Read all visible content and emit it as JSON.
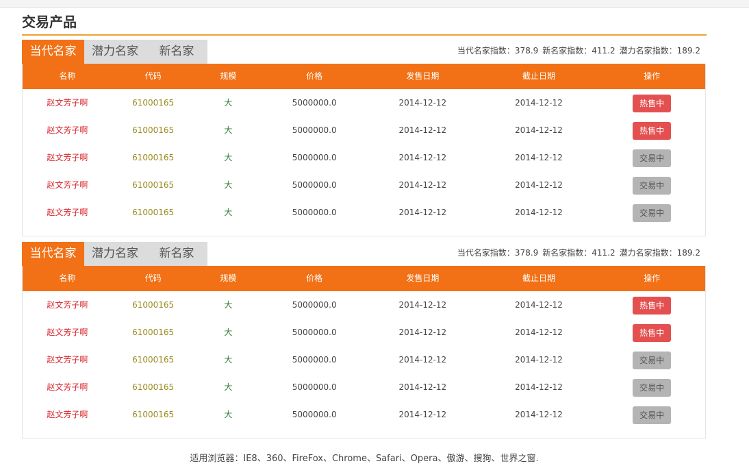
{
  "page": {
    "title": "交易产品"
  },
  "blocks": [
    {
      "tabs": [
        "当代名家",
        "潜力名家",
        "新名家"
      ],
      "active_tab": 0,
      "indices": [
        "当代名家指数：378.9",
        "新名家指数：411.2",
        "潜力名家指数：189.2"
      ],
      "headers": [
        "名称",
        "代码",
        "规模",
        "价格",
        "发售日期",
        "截止日期",
        "操作"
      ],
      "rows": [
        {
          "name": "赵文芳子啊",
          "code": "61000165",
          "scale": "大",
          "price": "5000000.0",
          "start": "2014-12-12",
          "end": "2014-12-12",
          "action": "热售中",
          "status": "hot"
        },
        {
          "name": "赵文芳子啊",
          "code": "61000165",
          "scale": "大",
          "price": "5000000.0",
          "start": "2014-12-12",
          "end": "2014-12-12",
          "action": "热售中",
          "status": "hot"
        },
        {
          "name": "赵文芳子啊",
          "code": "61000165",
          "scale": "大",
          "price": "5000000.0",
          "start": "2014-12-12",
          "end": "2014-12-12",
          "action": "交易中",
          "status": "trade"
        },
        {
          "name": "赵文芳子啊",
          "code": "61000165",
          "scale": "大",
          "price": "5000000.0",
          "start": "2014-12-12",
          "end": "2014-12-12",
          "action": "交易中",
          "status": "trade"
        },
        {
          "name": "赵文芳子啊",
          "code": "61000165",
          "scale": "大",
          "price": "5000000.0",
          "start": "2014-12-12",
          "end": "2014-12-12",
          "action": "交易中",
          "status": "trade"
        }
      ]
    },
    {
      "tabs": [
        "当代名家",
        "潜力名家",
        "新名家"
      ],
      "active_tab": 0,
      "indices": [
        "当代名家指数：378.9",
        "新名家指数：411.2",
        "潜力名家指数：189.2"
      ],
      "headers": [
        "名称",
        "代码",
        "规模",
        "价格",
        "发售日期",
        "截止日期",
        "操作"
      ],
      "rows": [
        {
          "name": "赵文芳子啊",
          "code": "61000165",
          "scale": "大",
          "price": "5000000.0",
          "start": "2014-12-12",
          "end": "2014-12-12",
          "action": "热售中",
          "status": "hot"
        },
        {
          "name": "赵文芳子啊",
          "code": "61000165",
          "scale": "大",
          "price": "5000000.0",
          "start": "2014-12-12",
          "end": "2014-12-12",
          "action": "热售中",
          "status": "hot"
        },
        {
          "name": "赵文芳子啊",
          "code": "61000165",
          "scale": "大",
          "price": "5000000.0",
          "start": "2014-12-12",
          "end": "2014-12-12",
          "action": "交易中",
          "status": "trade"
        },
        {
          "name": "赵文芳子啊",
          "code": "61000165",
          "scale": "大",
          "price": "5000000.0",
          "start": "2014-12-12",
          "end": "2014-12-12",
          "action": "交易中",
          "status": "trade"
        },
        {
          "name": "赵文芳子啊",
          "code": "61000165",
          "scale": "大",
          "price": "5000000.0",
          "start": "2014-12-12",
          "end": "2014-12-12",
          "action": "交易中",
          "status": "trade"
        }
      ]
    }
  ],
  "footer": {
    "text": "适用浏览器：IE8、360、FireFox、Chrome、Safari、Opera、傲游、搜狗、世界之窗."
  },
  "colors": {
    "accent": "#f27116",
    "hot": "#e45050",
    "trade": "#b4b4b4",
    "rule": "#f0a030"
  }
}
